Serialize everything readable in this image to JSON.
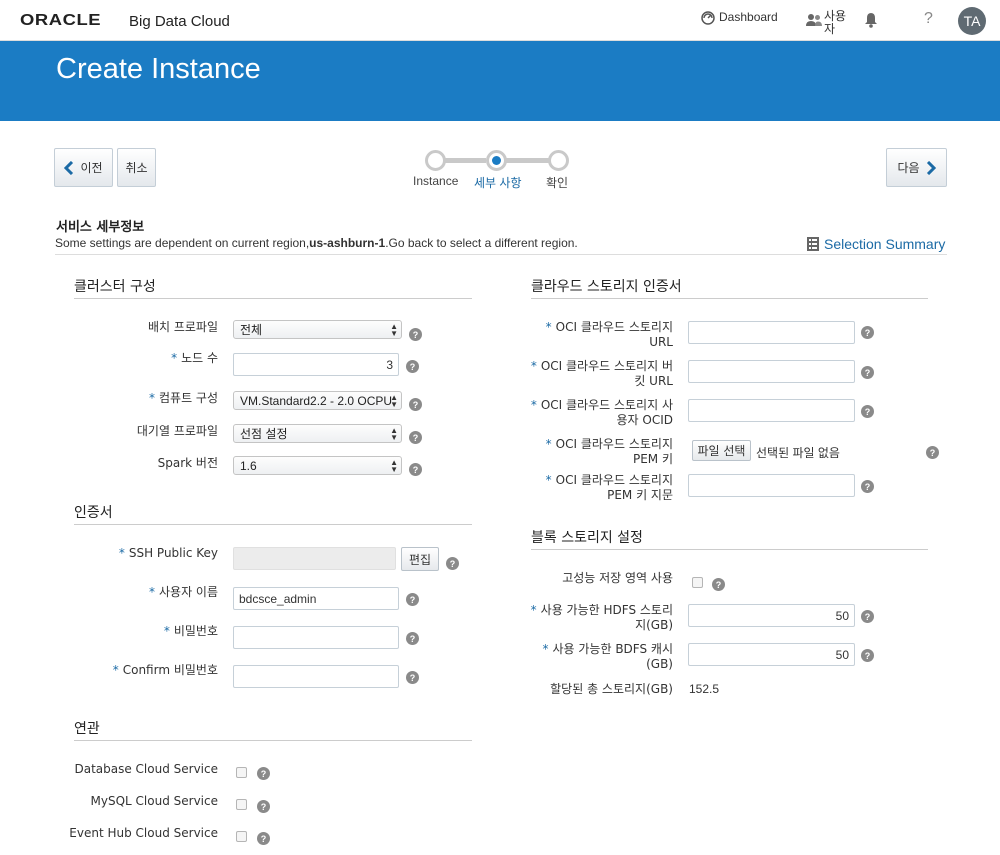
{
  "header": {
    "brand": "ORACLE",
    "product": "Big Data Cloud",
    "dashboard_label": "Dashboard",
    "users_label": "사용자",
    "help_label": "?",
    "avatar_initials": "TA"
  },
  "banner": {
    "title": "Create Instance"
  },
  "nav": {
    "back_label": "이전",
    "cancel_label": "취소",
    "next_label": "다음"
  },
  "train": {
    "steps": [
      {
        "label": "Instance",
        "state": "visited"
      },
      {
        "label": "세부 사항",
        "state": "current"
      },
      {
        "label": "확인",
        "state": "unvisited"
      }
    ]
  },
  "section": {
    "title": "서비스 세부정보",
    "note_prefix": "Some settings are dependent on current region,",
    "note_region": "us-ashburn-1",
    "note_suffix": ".Go back to select a different region.",
    "selection_summary": "Selection Summary"
  },
  "cluster": {
    "title": "클러스터 구성",
    "deployment_profile_label": "배치 프로파일",
    "deployment_profile_value": "전체",
    "node_count_label": "노드 수",
    "node_count_value": "3",
    "compute_shape_label": "컴퓨트 구성",
    "compute_shape_value": "VM.Standard2.2 - 2.0 OCPU",
    "queue_profile_label": "대기열 프로파일",
    "queue_profile_value": "선점 설정",
    "spark_version_label": "Spark 버전",
    "spark_version_value": "1.6"
  },
  "credentials": {
    "title": "인증서",
    "ssh_label": "SSH Public Key",
    "ssh_edit": "편집",
    "username_label": "사용자 이름",
    "username_value": "bdcsce_admin",
    "password_label": "비밀번호",
    "confirm_label": "Confirm 비밀번호"
  },
  "associations": {
    "title": "연관",
    "items": [
      "Database Cloud Service",
      "MySQL Cloud Service",
      "Event Hub Cloud Service"
    ]
  },
  "cloud_storage": {
    "title": "클라우드 스토리지 인증서",
    "url_label_1": "OCI 클라우드 스토리지",
    "url_label_2": "URL",
    "bucket_label_1": "OCI 클라우드 스토리지 버",
    "bucket_label_2": "킷 URL",
    "user_label_1": "OCI 클라우드 스토리지 사",
    "user_label_2": "용자 OCID",
    "pem_label_1": "OCI 클라우드 스토리지",
    "pem_label_2": "PEM 키",
    "pem_button": "파일 선택",
    "pem_status": "선택된 파일 없음",
    "fingerprint_label_1": "OCI 클라우드 스토리지",
    "fingerprint_label_2": "PEM 키 지문"
  },
  "block_storage": {
    "title": "블록 스토리지 설정",
    "hp_label": "고성능 저장 영역 사용",
    "hdfs_label_1": "사용 가능한 HDFS 스토리",
    "hdfs_label_2": "지(GB)",
    "hdfs_value": "50",
    "bdfs_label_1": "사용 가능한 BDFS 캐시",
    "bdfs_label_2": "(GB)",
    "bdfs_value": "50",
    "total_label": "할당된 총 스토리지(GB)",
    "total_value": "152.5"
  },
  "colors": {
    "banner": "#1b7cc4",
    "accent": "#1b6aa5",
    "step_active": "#1b7cc4"
  }
}
